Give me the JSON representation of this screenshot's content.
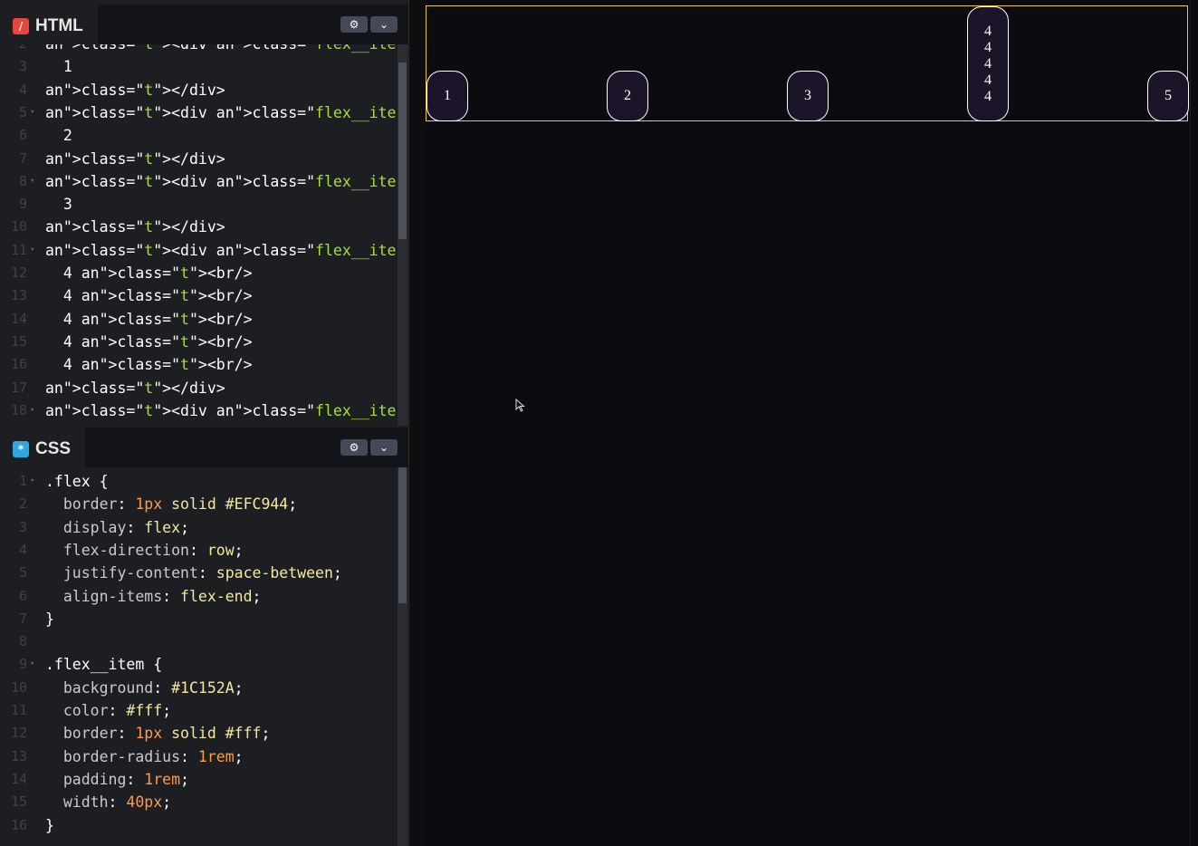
{
  "html_pane": {
    "label": "HTML",
    "icon": "/",
    "settings_icon": "⚙",
    "chevron_icon": "⌄",
    "lines": [
      {
        "n": "2",
        "fold": "▾",
        "code": "<div class=\"flex__item\">"
      },
      {
        "n": "3",
        "fold": "",
        "code": "  1"
      },
      {
        "n": "4",
        "fold": "",
        "code": "</div>"
      },
      {
        "n": "5",
        "fold": "▾",
        "code": "<div class=\"flex__item\">"
      },
      {
        "n": "6",
        "fold": "",
        "code": "  2"
      },
      {
        "n": "7",
        "fold": "",
        "code": "</div>"
      },
      {
        "n": "8",
        "fold": "▾",
        "code": "<div class=\"flex__item\">"
      },
      {
        "n": "9",
        "fold": "",
        "code": "  3"
      },
      {
        "n": "10",
        "fold": "",
        "code": "</div>"
      },
      {
        "n": "11",
        "fold": "▾",
        "code": "<div class=\"flex__item\">"
      },
      {
        "n": "12",
        "fold": "",
        "code": "  4 <br/>"
      },
      {
        "n": "13",
        "fold": "",
        "code": "  4 <br/>"
      },
      {
        "n": "14",
        "fold": "",
        "code": "  4 <br/>"
      },
      {
        "n": "15",
        "fold": "",
        "code": "  4 <br/>"
      },
      {
        "n": "16",
        "fold": "",
        "code": "  4 <br/>"
      },
      {
        "n": "17",
        "fold": "",
        "code": "</div>"
      },
      {
        "n": "18",
        "fold": "▾",
        "code": "<div class=\"flex__item\">"
      }
    ]
  },
  "css_pane": {
    "label": "CSS",
    "icon": "*",
    "settings_icon": "⚙",
    "chevron_icon": "⌄",
    "lines": [
      {
        "n": "1",
        "fold": "▾",
        "code": ".flex {"
      },
      {
        "n": "2",
        "fold": "",
        "code": "  border: 1px solid #EFC944;"
      },
      {
        "n": "3",
        "fold": "",
        "code": "  display: flex;"
      },
      {
        "n": "4",
        "fold": "",
        "code": "  flex-direction: row;"
      },
      {
        "n": "5",
        "fold": "",
        "code": "  justify-content: space-between;"
      },
      {
        "n": "6",
        "fold": "",
        "code": "  align-items: flex-end;"
      },
      {
        "n": "7",
        "fold": "",
        "code": "}"
      },
      {
        "n": "8",
        "fold": "",
        "code": ""
      },
      {
        "n": "9",
        "fold": "▾",
        "code": ".flex__item {"
      },
      {
        "n": "10",
        "fold": "",
        "code": "  background: #1C152A;"
      },
      {
        "n": "11",
        "fold": "",
        "code": "  color: #fff;"
      },
      {
        "n": "12",
        "fold": "",
        "code": "  border: 1px solid #fff;"
      },
      {
        "n": "13",
        "fold": "",
        "code": "  border-radius: 1rem;"
      },
      {
        "n": "14",
        "fold": "",
        "code": "  padding: 1rem;"
      },
      {
        "n": "15",
        "fold": "",
        "code": "  width: 40px;"
      },
      {
        "n": "16",
        "fold": "",
        "code": "}"
      }
    ]
  },
  "preview": {
    "items": [
      "1",
      "2",
      "3",
      "4\n4\n4\n4\n4",
      "5"
    ],
    "flex_border_color": "#EFC944",
    "item_background": "#1C152A"
  },
  "colors": {
    "html_icon": "#e8453c",
    "css_icon": "#2fa7e0"
  }
}
